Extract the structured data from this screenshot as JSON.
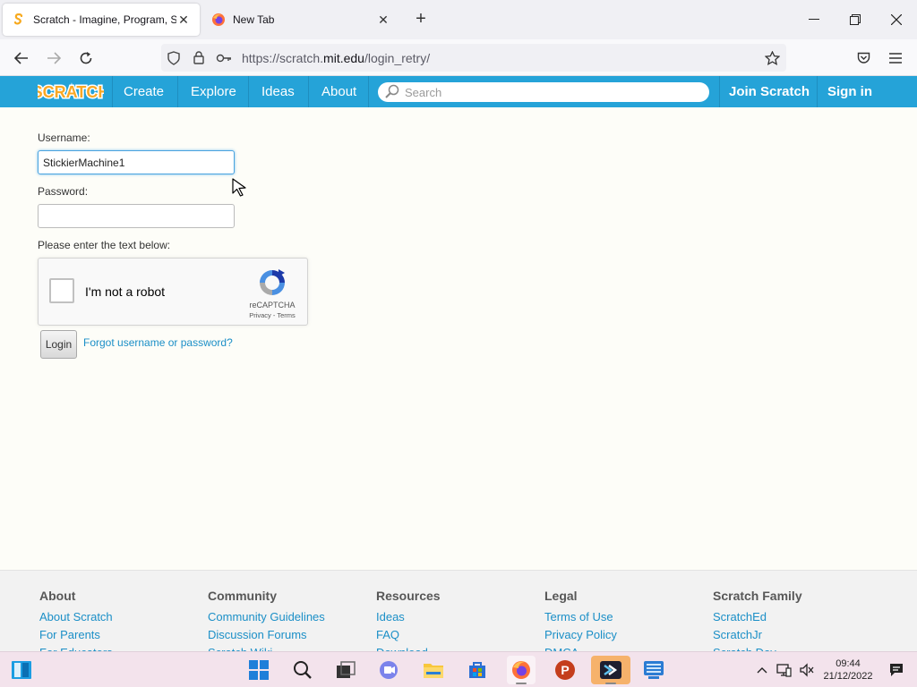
{
  "browser": {
    "tabs": [
      {
        "title": "Scratch - Imagine, Program, Share",
        "active": true
      },
      {
        "title": "New Tab",
        "active": false
      }
    ],
    "url_prefix": "https://scratch.",
    "url_domain": "mit.edu",
    "url_path": "/login_retry/"
  },
  "scratch_nav": {
    "logo_text": "SCRATCH",
    "items": [
      "Create",
      "Explore",
      "Ideas",
      "About"
    ],
    "search_placeholder": "Search",
    "join": "Join Scratch",
    "signin": "Sign in"
  },
  "login": {
    "username_label": "Username:",
    "username_value": "StickierMachine1",
    "password_label": "Password:",
    "password_value": "",
    "captcha_prompt": "Please enter the text below:",
    "captcha_text": "I'm not a robot",
    "recaptcha_name": "reCAPTCHA",
    "recaptcha_links": "Privacy - Terms",
    "login_button": "Login",
    "forgot_link": "Forgot username or password?"
  },
  "footer": {
    "columns": [
      {
        "title": "About",
        "links": [
          "About Scratch",
          "For Parents",
          "For Educators"
        ]
      },
      {
        "title": "Community",
        "links": [
          "Community Guidelines",
          "Discussion Forums",
          "Scratch Wiki"
        ]
      },
      {
        "title": "Resources",
        "links": [
          "Ideas",
          "FAQ",
          "Download"
        ]
      },
      {
        "title": "Legal",
        "links": [
          "Terms of Use",
          "Privacy Policy",
          "DMCA"
        ]
      },
      {
        "title": "Scratch Family",
        "links": [
          "ScratchEd",
          "ScratchJr",
          "Scratch Day"
        ]
      }
    ]
  },
  "taskbar": {
    "time": "09:44",
    "date": "21/12/2022",
    "icons": [
      "widgets-icon",
      "windows-start-icon",
      "search-icon",
      "task-view-icon",
      "teams-chat-icon",
      "file-explorer-icon",
      "store-icon",
      "firefox-icon",
      "powerpoint-icon",
      "terminal-app-icon",
      "keyboard-app-icon"
    ]
  },
  "colors": {
    "scratch_blue": "#25a3d8",
    "link_blue": "#1b8fc7",
    "page_bg": "#fdfdf8",
    "taskbar_bg": "#f3e3ec"
  }
}
